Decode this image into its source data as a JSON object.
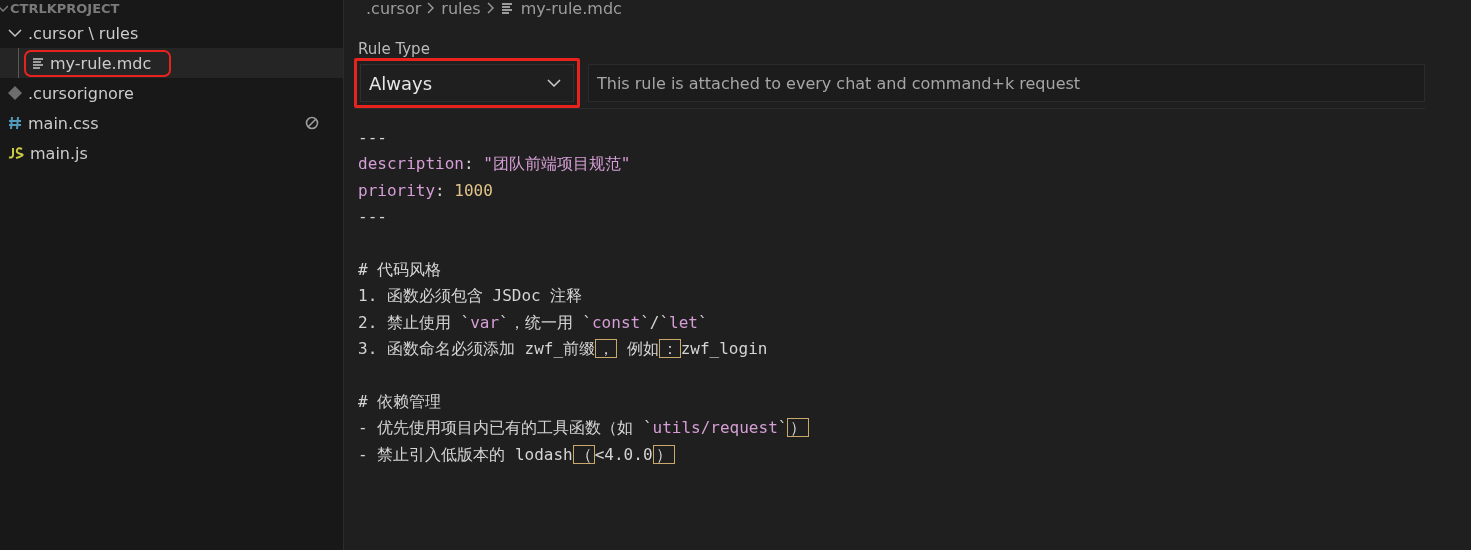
{
  "sidebar": {
    "title": "CTRLKPROJECT",
    "expanded": true,
    "items": [
      {
        "label": ".cursor \\ rules",
        "kind": "folder",
        "expanded": true,
        "selected": false,
        "highlighted": false,
        "children": [
          {
            "label": "my-rule.mdc",
            "kind": "lines",
            "selected": true,
            "highlighted": true
          }
        ]
      },
      {
        "label": ".cursorignore",
        "kind": "diamond",
        "selected": false,
        "highlighted": false,
        "decoration": false
      },
      {
        "label": "main.css",
        "kind": "hash",
        "selected": false,
        "highlighted": false,
        "decoration": true
      },
      {
        "label": "main.js",
        "kind": "js",
        "selected": false,
        "highlighted": false,
        "decoration": false
      }
    ]
  },
  "breadcrumb": [
    {
      "label": ".cursor",
      "kind": "folder"
    },
    {
      "label": "rules",
      "kind": "folder"
    },
    {
      "label": "my-rule.mdc",
      "kind": "file"
    }
  ],
  "rule_type": {
    "label": "Rule Type",
    "value": "Always",
    "highlighted": true,
    "description": "This rule is attached to every chat and command+k request"
  },
  "code_lines": [
    {
      "kind": "text",
      "tokens": [
        {
          "text": "---",
          "kind": "plain"
        }
      ]
    },
    {
      "kind": "text",
      "tokens": [
        {
          "text": "description",
          "kind": "key"
        },
        {
          "text": ": ",
          "kind": "plain"
        },
        {
          "text": "\"团队前端项目规范\"",
          "kind": "string"
        }
      ]
    },
    {
      "kind": "text",
      "tokens": [
        {
          "text": "priority",
          "kind": "key"
        },
        {
          "text": ": ",
          "kind": "plain"
        },
        {
          "text": "1000",
          "kind": "number"
        }
      ]
    },
    {
      "kind": "text",
      "tokens": [
        {
          "text": "---",
          "kind": "plain"
        }
      ]
    },
    {
      "kind": "blank"
    },
    {
      "kind": "text",
      "tokens": [
        {
          "text": "# 代码风格",
          "kind": "plain"
        }
      ]
    },
    {
      "kind": "text",
      "tokens": [
        {
          "text": "1. 函数必须包含 JSDoc 注释",
          "kind": "plain"
        }
      ]
    },
    {
      "kind": "text",
      "tokens": [
        {
          "text": "2. 禁止使用 `",
          "kind": "plain"
        },
        {
          "text": "var",
          "kind": "code"
        },
        {
          "text": "`，统一用 `",
          "kind": "plain"
        },
        {
          "text": "const",
          "kind": "code"
        },
        {
          "text": "`/`",
          "kind": "plain"
        },
        {
          "text": "let",
          "kind": "code"
        },
        {
          "text": "`",
          "kind": "plain"
        }
      ]
    },
    {
      "kind": "text",
      "tokens": [
        {
          "text": "3. 函数命名必须添加 zwf_前缀",
          "kind": "plain"
        },
        {
          "text": "，",
          "kind": "ambiguous"
        },
        {
          "text": " 例如",
          "kind": "plain"
        },
        {
          "text": "：",
          "kind": "ambiguous"
        },
        {
          "text": "zwf_login",
          "kind": "plain"
        }
      ]
    },
    {
      "kind": "blank"
    },
    {
      "kind": "text",
      "tokens": [
        {
          "text": "# 依赖管理",
          "kind": "plain"
        }
      ]
    },
    {
      "kind": "text",
      "tokens": [
        {
          "text": "- 优先使用项目内已有的工具函数（如 `",
          "kind": "plain"
        },
        {
          "text": "utils/request",
          "kind": "code"
        },
        {
          "text": "`",
          "kind": "plain"
        },
        {
          "text": "）",
          "kind": "ambiguous"
        }
      ]
    },
    {
      "kind": "text",
      "tokens": [
        {
          "text": "- 禁止引入低版本的 lodash",
          "kind": "plain"
        },
        {
          "text": "（",
          "kind": "ambiguous"
        },
        {
          "text": "<4.0.",
          "kind": "plain"
        },
        {
          "text": "0",
          "kind": "plain"
        },
        {
          "text": "）",
          "kind": "ambiguous"
        }
      ]
    }
  ]
}
